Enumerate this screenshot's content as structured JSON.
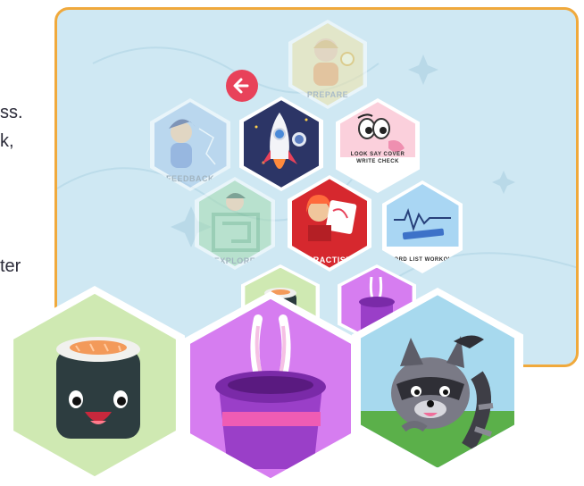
{
  "edge_text": [
    "ss.",
    "k,",
    "ter"
  ],
  "menu": {
    "back_label": "back",
    "tiles": {
      "prepare": "PREPARE",
      "feedback": "FEEDBACK",
      "look_say": "LOOK SAY COVER WRITE CHECK",
      "explore": "EXPLORE",
      "practise": "PRACTISE",
      "word_list": "WORD LIST WORKOUT"
    }
  },
  "colors": {
    "panel_border": "#f0a93c",
    "panel_bg": "#cfe8f3",
    "back_button": "#e8425a",
    "practise_tile": "#d6282e",
    "rocket_tile": "#2c3566"
  },
  "icons": [
    "arrow-left-icon",
    "rocket-icon",
    "sushi-icon",
    "magic-hat-icon",
    "raccoon-icon"
  ]
}
